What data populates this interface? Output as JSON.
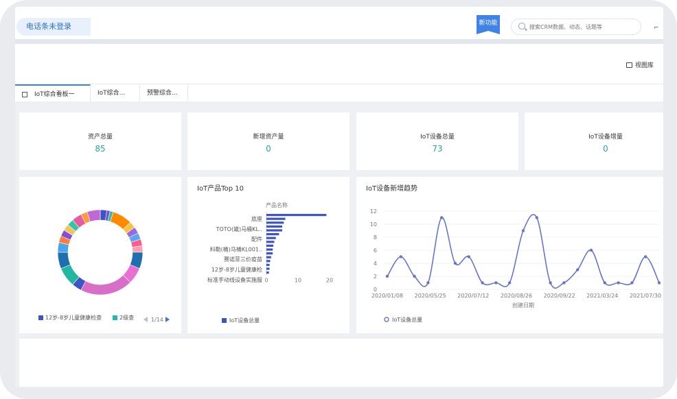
{
  "header": {
    "phone_status": "电话条未登录",
    "new_feature": "新功能",
    "search_placeholder": "搜索CRM数据、动态、话题等",
    "user_mark": "⌐"
  },
  "toolbar": {
    "view_library": "视图库"
  },
  "tabs": [
    {
      "label": "IoT综合看板一"
    },
    {
      "label": "IoT综合..."
    },
    {
      "label": "预警综合..."
    }
  ],
  "kpis": [
    {
      "label": "资产总量",
      "value": "85"
    },
    {
      "label": "新增资产量",
      "value": "0"
    },
    {
      "label": "IoT设备总量",
      "value": "73"
    },
    {
      "label": "IoT设备增量",
      "value": "0"
    }
  ],
  "colors": {
    "accent": "#3f82e8",
    "kpi_value": "#25a69a",
    "bar": "#3d55c4",
    "line": "#6574cd"
  },
  "chart_data": [
    {
      "type": "pie",
      "donut": true,
      "legend": {
        "items": [
          "12岁-8岁儿童健康检查",
          "2级查"
        ],
        "colors": [
          "#3d55c4",
          "#25b7a8"
        ],
        "page": "1/14"
      },
      "values": [
        2,
        1,
        1,
        6,
        2,
        2,
        2,
        2,
        2,
        5,
        5,
        16,
        3,
        6,
        5,
        3,
        2,
        2,
        2,
        2,
        3,
        2,
        4
      ],
      "colors": [
        "#3d55c4",
        "#7c4dd6",
        "#2fbfa6",
        "#ff8a00",
        "#f5c542",
        "#9c6ade",
        "#56a8f5",
        "#ff5c8a",
        "#ff9fb5",
        "#1f6fae",
        "#e86fd3",
        "#d86ec7",
        "#3d55c4",
        "#22b7a0",
        "#1f6fae",
        "#4aa5e8",
        "#ff7c3c",
        "#7f4fd9",
        "#f7c25c",
        "#33c6a5",
        "#e85b9e",
        "#ff9b3d",
        "#c268d6"
      ]
    },
    {
      "type": "bar",
      "orientation": "horizontal",
      "title": "IoT产品Top 10",
      "ylabel": "产品名称",
      "category_labels": [
        "底座",
        "TOTO(箴)马桶KL..",
        "配件",
        "科勒(桶)马桶KL001..",
        "赛诺菲三价疫苗",
        "12岁-8岁儿童健康检",
        "标准手动线设备实施服"
      ],
      "values": [
        19,
        6,
        5.5,
        5,
        5,
        4,
        3,
        2.5,
        2.2,
        2,
        2,
        1.5,
        1.2,
        1,
        1,
        0.8
      ],
      "xlim": [
        0,
        20
      ],
      "xticks": [
        "0",
        "10",
        "20"
      ],
      "legend": "IoT设备总量"
    },
    {
      "type": "line",
      "title": "IoT设备新增趋势",
      "xlabel": "创建日期",
      "ylim": [
        0,
        12
      ],
      "yticks": [
        "0",
        "2",
        "4",
        "6",
        "8",
        "10",
        "12"
      ],
      "xtick_labels": [
        "2020/01/08",
        "2020/05/25",
        "2020/07/12",
        "2020/08/26",
        "2020/09/22",
        "2021/03/24",
        "2021/07/30"
      ],
      "values": [
        2,
        5,
        2,
        1,
        11,
        4,
        5,
        1,
        1,
        1,
        9,
        11,
        1,
        1,
        3,
        6,
        1,
        1,
        1,
        5,
        1
      ],
      "legend": "IoT设备总量"
    }
  ]
}
